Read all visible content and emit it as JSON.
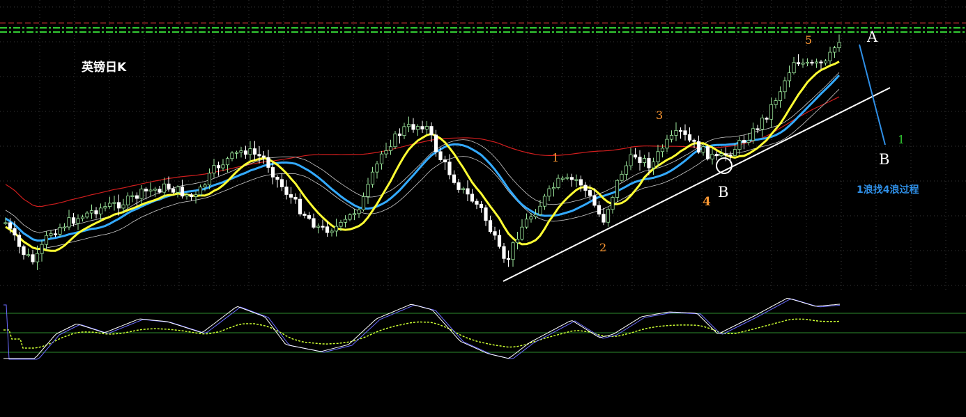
{
  "chart_data": {
    "type": "candlestick",
    "title": "英镑日K",
    "annotations": {
      "wave_labels": [
        "1",
        "2",
        "3",
        "4",
        "5"
      ],
      "point_labels": [
        "A",
        "B",
        "B"
      ],
      "side_count": "1",
      "note": "1浪找4浪过程"
    },
    "grid": true,
    "indicator_panel": "stochastic"
  },
  "colors": {
    "background": "#000000",
    "bull_candle": "#9be59b",
    "bear_candle": "#ffffff",
    "ma_fast": "#ffff33",
    "ma_mid": "#33aaff",
    "ma_slow": "#d21e1e",
    "trendline": "#ffffff",
    "wave_label": "#ff9933",
    "resistance_line": "#33cc33",
    "stoch_main": "#ffffff",
    "stoch_signal": "#ccff33"
  }
}
